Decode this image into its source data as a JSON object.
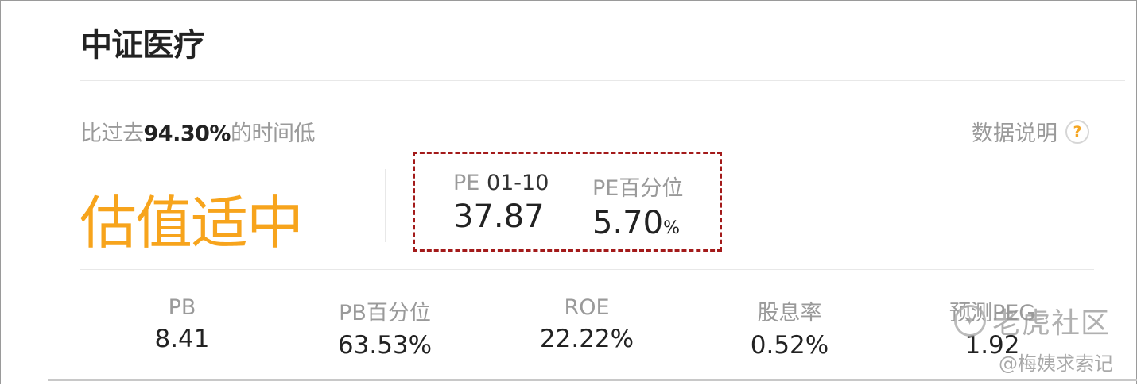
{
  "title": "中证医疗",
  "comparison": {
    "prefix": "比过去",
    "percent": "94.30%",
    "suffix": "的时间低"
  },
  "help": {
    "label": "数据说明",
    "icon": "question-circle-icon"
  },
  "valuation_status": "估值适中",
  "highlight_metrics": {
    "pe": {
      "label": "PE",
      "range": "01-10",
      "value": "37.87"
    },
    "pe_percentile": {
      "label": "PE百分位",
      "value": "5.70",
      "unit": "%"
    }
  },
  "stats": [
    {
      "label": "PB",
      "value": "8.41"
    },
    {
      "label": "PB百分位",
      "value": "63.53%"
    },
    {
      "label": "ROE",
      "value": "22.22%"
    },
    {
      "label": "股息率",
      "value": "0.52%"
    },
    {
      "label": "预测PEG",
      "value": "1.92"
    }
  ],
  "watermark": {
    "text": "老虎社区",
    "credit": "@梅姨求索记"
  },
  "colors": {
    "accent": "#f7a41c",
    "highlight_border": "#a31a1a",
    "muted": "#9a9a9a"
  }
}
